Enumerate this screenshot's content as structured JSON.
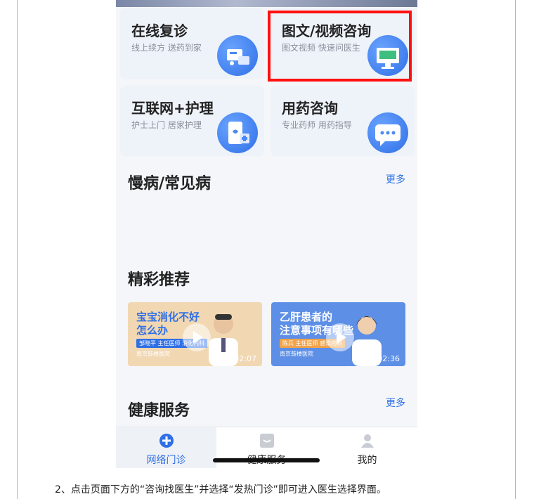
{
  "services": [
    {
      "title": "在线复诊",
      "subtitle": "线上续方 送药到家",
      "icon": "pill-delivery-icon"
    },
    {
      "title": "图文/视频咨询",
      "subtitle": "图文视频 快速问医生",
      "icon": "monitor-icon"
    },
    {
      "title": "互联网+护理",
      "subtitle": "护士上门 居家护理",
      "icon": "phone-care-icon"
    },
    {
      "title": "用药咨询",
      "subtitle": "专业药师 用药指导",
      "icon": "chat-bubble-icon"
    }
  ],
  "sections": {
    "chronic": {
      "title": "慢病/常见病",
      "more": "更多"
    },
    "featured": {
      "title": "精彩推荐"
    },
    "health": {
      "title": "健康服务",
      "more": "更多"
    }
  },
  "videos": [
    {
      "title_line1": "宝宝消化不好",
      "title_line2": "怎么办",
      "tag": "邹晓平 主任医师 消化内科",
      "hospital": "南京鼓楼医院",
      "duration": "02:07"
    },
    {
      "title_line1": "乙肝患者的",
      "title_line2": "注意事项有哪些",
      "tag": "陈兵 主任医师 感染内科",
      "hospital": "南京鼓楼医院",
      "duration": "02:36"
    }
  ],
  "tabs": [
    {
      "label": "网络门诊",
      "active": true,
      "icon": "plus-circle-icon"
    },
    {
      "label": "健康服务",
      "active": false,
      "icon": "tray-icon"
    },
    {
      "label": "我的",
      "active": false,
      "icon": "person-icon"
    }
  ],
  "caption": "2、点击页面下方的“咨询找医生”并选择“发热门诊”即可进入医生选择界面。",
  "colors": {
    "accent": "#2f6fe6",
    "highlight": "#ff1010"
  }
}
